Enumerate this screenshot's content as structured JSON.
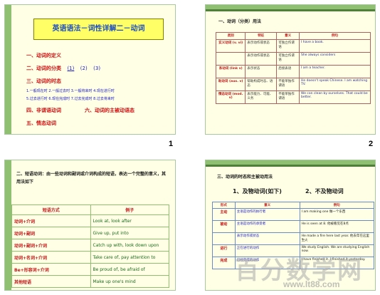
{
  "slide1": {
    "title": "英语语法－词性详解二－动词",
    "items": [
      "一、动词的定义",
      "二、动词的分类",
      "三、动词的时态",
      "四、非谓语动词",
      "五、情态动词"
    ],
    "class_links": [
      "(1)",
      "(2)",
      "(3)"
    ],
    "tenses_row1": "1.一般现在时 2.一般过去时 3.一般将来时 4.现在进行时",
    "tenses_row2": "5.过去进行时 6.现在完成时 7.过去完成时 8.过去将来时",
    "item4_extra": "六、动词的主被动语态",
    "page": "1"
  },
  "slide2": {
    "heading": "一、动词（分类）用法",
    "headers": [
      "类别",
      "特征",
      "意义",
      "例句"
    ],
    "rows": [
      {
        "kind": "实义动词 (v. vi)",
        "feature": "表示动作或状态",
        "meaning": "可独立作谓语",
        "example": "I have a book."
      },
      {
        "kind": "",
        "feature": "表示动作或状态",
        "meaning": "可独立作谓语",
        "example": "She always considers"
      },
      {
        "kind": "系动词 (link v)",
        "feature": "表示状态",
        "meaning": "后接表语",
        "example": "I am a teacher."
      },
      {
        "kind": "助动词 (aux. v)",
        "feature": "帮助构成时态、语态",
        "meaning": "不能单独作谓语",
        "example": "He doesn't speak Chinese. I am watching TV."
      },
      {
        "kind": "情态动词 (mod. v)",
        "feature": "表示能力、可能、义务",
        "meaning": "不能单独作谓语",
        "example": "We can clean by ourselves. That could be better."
      }
    ],
    "page": "2"
  },
  "slide3": {
    "heading": "二、短语动词：由一些动词和副词或介词构成的短语，表达一个完整的意义，其用法如下",
    "headers": [
      "短语方式",
      "例子"
    ],
    "rows": [
      {
        "pattern": "动词+介词",
        "example": "Look at, look after"
      },
      {
        "pattern": "动词+副词",
        "example": "Give up, put into"
      },
      {
        "pattern": "动词+副词+介词",
        "example": "Catch up with, look down upon"
      },
      {
        "pattern": "动词+名词+介词",
        "example": "Take care of, pay attention to"
      },
      {
        "pattern": "Be+形容词+介词",
        "example": "Be proud of, be afraid of"
      },
      {
        "pattern": "其他短语",
        "example": "Make up one's mind"
      }
    ]
  },
  "slide4": {
    "heading": "三、动词的时态和主被动用法",
    "sub1": "1、及物动词(如下)",
    "sub2": "2、不及物动词",
    "headers": [
      "形式",
      "意义",
      "例句"
    ],
    "rows": [
      {
        "kind": "主动",
        "meaning": "主语是动作的执行者",
        "example": "I am making one 做一个东西"
      },
      {
        "kind": "被动",
        "meaning": "主语是动作的承受者",
        "example": "He is seen at 8. 他被看见在8点"
      },
      {
        "kind": "",
        "meaning": "表示动作或状态",
        "example": "He made a fire here last year. 他去年在这里生火"
      },
      {
        "kind": "进行",
        "meaning": "正在进行的动作",
        "example": "We study English. We are studying English now."
      },
      {
        "kind": "完成",
        "meaning": "已经完成的动作",
        "example": "I have finished it. I finished it yesterday."
      }
    ]
  },
  "watermark": "百分数学网",
  "watermark_url": "www.lt88.com"
}
